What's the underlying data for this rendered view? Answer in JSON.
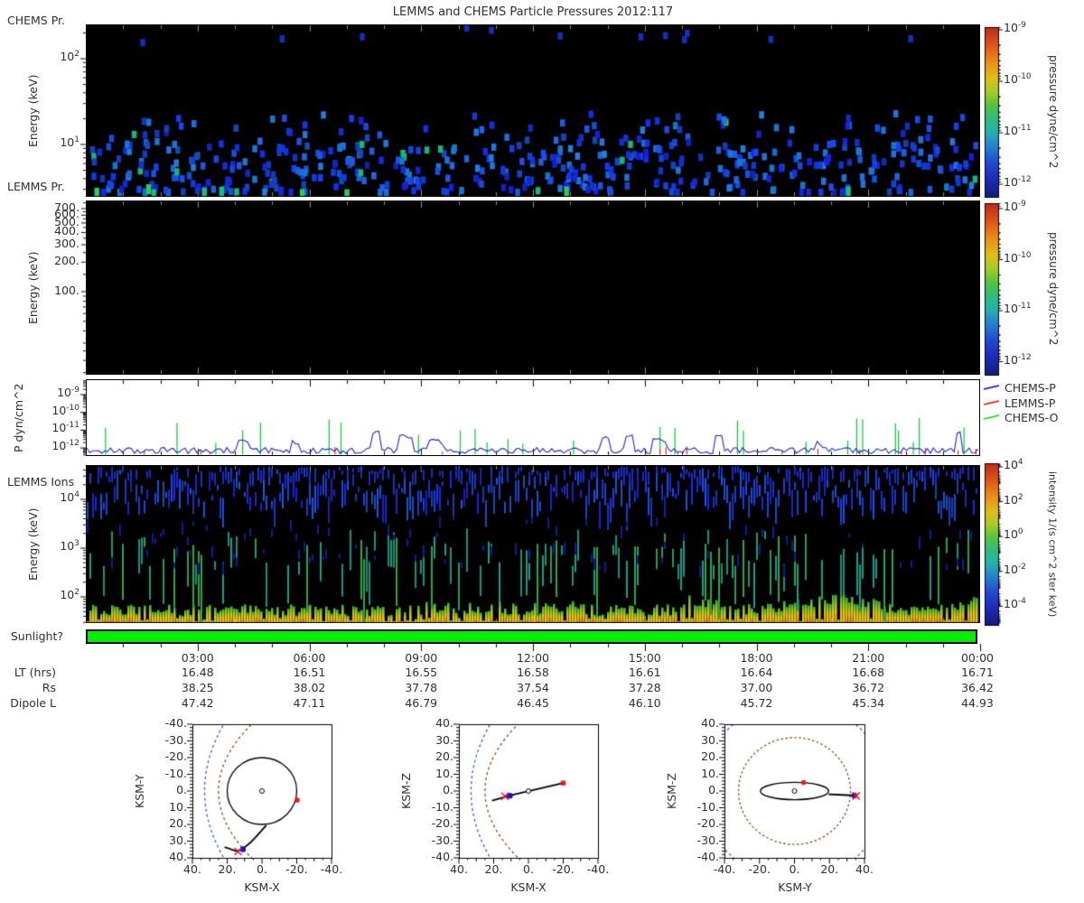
{
  "title": "LEMMS and CHEMS Particle Pressures  2012:117",
  "colors": {
    "background": "#ffffff",
    "panel_background": "#000000",
    "text": "#303030",
    "sunlight_green": "#00ee00",
    "chems_p_blue": "#0000ff",
    "lemms_p_red": "#ff0000",
    "chems_o_green": "#00dd00",
    "bow_shock_blue": "#3c5ce0",
    "magnetopause_brown": "#8f4a1c",
    "trajectory_black": "#000000",
    "marker_red": "#ee1c1c",
    "marker_blue": "#1414d2"
  },
  "chart_data": [
    {
      "panel": "CHEMS Pr.",
      "type": "heatmap",
      "ylabel": "Energy (keV)",
      "yscale": "log",
      "yrange_keV": [
        2.6,
        250
      ],
      "ytick_labels": [
        "10^2",
        "10^1"
      ],
      "xrange": "2012:117 00:00-24:00 UT",
      "colorbar": {
        "label": "pressure dyne/cm^2",
        "tick_labels": [
          "10^-9",
          "10^-10",
          "10^-11",
          "10^-12"
        ],
        "range": [
          1e-13,
          1e-09
        ]
      },
      "content": "sparse pixels: mostly blue (~1e-12 dyne/cm^2) at 3-10 keV, scattered 10-25 keV, occasional teal/green (~1e-11) at 3-6 keV, rare points 140-250 keV",
      "gen": {
        "seed": 7,
        "n_low": 430,
        "n_mid": 85,
        "n_high": 12,
        "n_green": 9
      }
    },
    {
      "panel": "LEMMS Pr.",
      "type": "heatmap",
      "ylabel": "Energy (keV)",
      "yscale": "log",
      "yrange_keV": [
        14,
        850
      ],
      "ytick_labels": [
        "700.",
        "600.",
        "500.",
        "400.",
        "300.",
        "200.",
        "100."
      ],
      "colorbar": {
        "label": "pressure dyne/cm^2",
        "tick_labels": [
          "10^-9",
          "10^-10",
          "10^-11",
          "10^-12"
        ],
        "range": [
          1e-13,
          1e-09
        ]
      },
      "content": "no pressure above threshold - panel entirely black"
    },
    {
      "panel": "P dyn/cm^2",
      "type": "line",
      "ylabel": "P dyn/cm^2",
      "yscale": "log",
      "ytick_labels": [
        "10^-9",
        "10^-10",
        "10^-11",
        "10^-12"
      ],
      "yrange": [
        3.5e-13,
        7e-09
      ],
      "series": [
        {
          "name": "CHEMS-P",
          "color": "#0000ff",
          "summary": "continuous noisy trace 4e-13 to 1e-11 with bumps to ~2e-11"
        },
        {
          "name": "LEMMS-P",
          "color": "#ff0000",
          "summary": "near plot floor ~4e-13; sparse small spikes, mostly after 18:00"
        },
        {
          "name": "CHEMS-O",
          "color": "#00dd00",
          "summary": "isolated vertical spikes from floor up to ~5e-11, denser after 21:00"
        }
      ],
      "legend_position": "right",
      "gen": {
        "seed": 11
      }
    },
    {
      "panel": "LEMMS Ions",
      "type": "heatmap",
      "ylabel": "Energy (keV)",
      "yscale": "log",
      "yrange_keV": [
        29,
        50000
      ],
      "ytick_labels": [
        "10^4",
        "10^3",
        "10^2"
      ],
      "colorbar": {
        "label": "intensity 1/(s cm^2 ster keV)",
        "tick_labels": [
          "10^4",
          "10^2",
          "10^0",
          "10^-2",
          "10^-4"
        ],
        "range": [
          1e-05,
          10000.0
        ]
      },
      "content": "dense vertical streaks: blue at 2e3-5e4 keV, teal at 1e2-1e3 keV, continuous yellow-orange band below ~70 keV, taller/denser bursts after ~18:00",
      "gen": {
        "seed": 23
      }
    },
    {
      "panel": "Sunlight?",
      "type": "indicator",
      "state": "on (green) for entire interval",
      "color": "#00ee00"
    },
    {
      "panel": "ephemeris",
      "type": "table",
      "hour_labels": [
        "03:00",
        "06:00",
        "09:00",
        "12:00",
        "15:00",
        "18:00",
        "21:00",
        "00:00"
      ],
      "rows": [
        {
          "label": "LT (hrs)",
          "values": [
            "16.48",
            "16.51",
            "16.55",
            "16.58",
            "16.61",
            "16.64",
            "16.68",
            "16.71"
          ]
        },
        {
          "label": "Rs",
          "values": [
            "38.25",
            "38.02",
            "37.78",
            "37.54",
            "37.28",
            "37.00",
            "36.72",
            "36.42"
          ]
        },
        {
          "label": "Dipole L",
          "values": [
            "47.42",
            "47.11",
            "46.79",
            "46.45",
            "46.10",
            "45.72",
            "45.34",
            "44.93"
          ]
        }
      ]
    },
    {
      "panel": "orbit plots",
      "type": "scatter",
      "plots": [
        {
          "xlabel": "KSM-X",
          "ylabel": "KSM-Y",
          "xticks": [
            "40.",
            "20.",
            "0.",
            "-20.",
            "-40."
          ],
          "yticks": [
            "-40.",
            "-30.",
            "-20.",
            "-10.",
            "0.",
            "10.",
            "20.",
            "30.",
            "40."
          ],
          "xrange": [
            40,
            -40
          ],
          "yrange": [
            -40,
            40
          ],
          "bow_shock": {
            "style": "blue dashed parabola",
            "vertex_x": 33,
            "x_at_40": 22
          },
          "magnetopause": {
            "style": "brown dashed parabola",
            "vertex_x": 25,
            "x_at_40": 6
          },
          "reference_circle_radius": 20,
          "planet_radius": 1.3,
          "trajectory": [
            [
              -2.5,
              20.5
            ],
            [
              0.5,
              24
            ],
            [
              3.5,
              27.5
            ],
            [
              6.5,
              30.7
            ],
            [
              9.5,
              33.3
            ],
            [
              12,
              35
            ],
            [
              14.5,
              36
            ],
            [
              17,
              35.2
            ],
            [
              19.5,
              34.2
            ],
            [
              21.5,
              33.6
            ]
          ],
          "markers": {
            "red_dot": [
              -20.3,
              5.4
            ],
            "blue_dot": [
              11,
              34.9
            ],
            "red_x": [
              13.8,
              36.2
            ]
          }
        },
        {
          "xlabel": "KSM-X",
          "ylabel": "KSM-Z",
          "xticks": [
            "40.",
            "20.",
            "0.",
            "-20.",
            "-40."
          ],
          "yticks": [
            "40.",
            "30.",
            "20.",
            "10.",
            "0.",
            "-10.",
            "-20.",
            "-30.",
            "-40."
          ],
          "xrange": [
            40,
            -40
          ],
          "yrange": [
            40,
            -40
          ],
          "bow_shock": {
            "style": "blue dashed parabola",
            "vertex_x": 33,
            "x_at_40": 22
          },
          "magnetopause": {
            "style": "brown dashed parabola",
            "vertex_x": 25,
            "x_at_40": 6
          },
          "planet_radius": 1.3,
          "trajectory": [
            [
              21,
              -5.8
            ],
            [
              13,
              -3.4
            ],
            [
              10.5,
              -2.7
            ],
            [
              -20,
              4.8
            ]
          ],
          "markers": {
            "red_square": [
              -20,
              4.8
            ],
            "blue_dot": [
              10.7,
              -2.8
            ],
            "red_x": [
              13.5,
              -3.1
            ]
          }
        },
        {
          "xlabel": "KSM-Y",
          "ylabel": "KSM-Z",
          "xticks": [
            "-40.",
            "-20.",
            "0.",
            "20.",
            "40."
          ],
          "yticks": [
            "40.",
            "30.",
            "20.",
            "10.",
            "0.",
            "-10.",
            "-20.",
            "-30.",
            "-40."
          ],
          "xrange": [
            -40,
            40
          ],
          "yrange": [
            40,
            -40
          ],
          "bow_shock_circle_radius": 53,
          "magnetopause_circle_radius": 32,
          "orbit_ellipse": {
            "semi_axis_horizontal": 19.5,
            "semi_axis_vertical": 5.2
          },
          "planet_radius": 1.3,
          "trajectory": [
            [
              19.5,
              -2
            ],
            [
              27,
              -2.3
            ],
            [
              34.3,
              -2.7
            ]
          ],
          "markers": {
            "red_dot": [
              5.2,
              5.1
            ],
            "blue_dot": [
              34.2,
              -2.7
            ],
            "red_x": [
              35.3,
              -2.9
            ]
          }
        }
      ]
    }
  ]
}
